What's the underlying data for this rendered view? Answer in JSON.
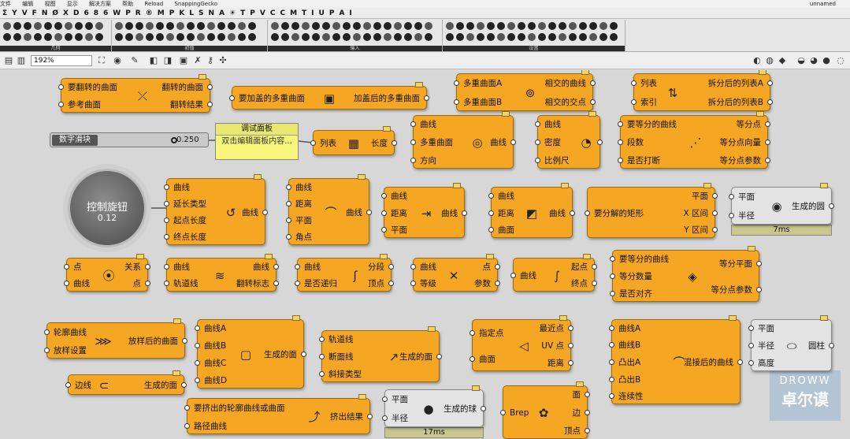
{
  "menubar": {
    "items": [
      "文件",
      "编辑",
      "视图",
      "显示",
      "解决方案",
      "帮助"
    ],
    "reload": "Reload",
    "plugin": "SnappingGecko",
    "doc": "unnamed"
  },
  "tabs": [
    "Σ",
    "Y",
    "V",
    "F",
    "N",
    "Ø",
    "X",
    "D",
    "6",
    "8",
    "6",
    "W",
    "P",
    "R",
    "®",
    "M",
    "P",
    "K",
    "L",
    "S",
    "N",
    "A",
    "☀",
    "T",
    "P",
    "V",
    "C",
    "C",
    "M",
    "T",
    "I",
    "U",
    "P",
    "A",
    "I"
  ],
  "ribbon_groups": [
    "几何",
    "初值",
    "输入",
    "设置"
  ],
  "toolbar": {
    "zoom": "192%"
  },
  "slider": {
    "name": "数字滑块",
    "value": "0.250"
  },
  "panel": {
    "title": "调试面板",
    "text": "双击编辑面板内容..."
  },
  "knob": {
    "name": "控制旋钮",
    "value": "0.12"
  },
  "timers": [
    "7ms",
    "17ms"
  ],
  "watermark": {
    "line1": "DROWW",
    "line2": "卓尔谟"
  },
  "nodes": [
    {
      "id": "flip",
      "inputs": [
        "要翻转的曲面",
        "参考曲面"
      ],
      "outputs": [
        "翻转的曲面",
        "翻转结果"
      ],
      "icon": "⤫"
    },
    {
      "id": "cap",
      "inputs": [
        "要加盖的多重曲面"
      ],
      "outputs": [
        "加盖后的多重曲面"
      ],
      "icon": "▣"
    },
    {
      "id": "mci",
      "inputs": [
        "多重曲面A",
        "多重曲面B"
      ],
      "outputs": [
        "相交的曲线",
        "相交的交点"
      ],
      "icon": "⊚"
    },
    {
      "id": "split",
      "inputs": [
        "列表",
        "索引"
      ],
      "outputs": [
        "拆分后的列表A",
        "拆分后的列表B"
      ],
      "icon": "⇅"
    },
    {
      "id": "len",
      "inputs": [
        "列表"
      ],
      "outputs": [
        "长度"
      ],
      "icon": "▦"
    },
    {
      "id": "offset",
      "inputs": [
        "曲线",
        "多重曲面",
        "方向"
      ],
      "outputs": [
        "曲线"
      ],
      "icon": "◎"
    },
    {
      "id": "fillet",
      "inputs": [
        "曲线",
        "密度",
        "比例尺"
      ],
      "outputs": [],
      "icon": "◔"
    },
    {
      "id": "divide",
      "inputs": [
        "要等分的曲线",
        "段数",
        "是否打断"
      ],
      "outputs": [
        "等分点",
        "等分点向量",
        "等分点参数"
      ],
      "icon": "⋰"
    },
    {
      "id": "extend",
      "inputs": [
        "曲线",
        "延长类型",
        "起点长度",
        "终点长度"
      ],
      "outputs": [
        "曲线"
      ],
      "icon": "↺"
    },
    {
      "id": "project",
      "inputs": [
        "曲线",
        "距离",
        "平面",
        "角点"
      ],
      "outputs": [
        "曲线"
      ],
      "icon": "⌒"
    },
    {
      "id": "offc",
      "inputs": [
        "曲线",
        "距离",
        "平面"
      ],
      "outputs": [
        "曲线"
      ],
      "icon": "⇥"
    },
    {
      "id": "offs",
      "inputs": [
        "曲线",
        "距离",
        "曲面"
      ],
      "outputs": [
        "曲线"
      ],
      "icon": "◩"
    },
    {
      "id": "rect",
      "inputs": [
        "要分解的矩形"
      ],
      "outputs": [
        "平面",
        "X 区间",
        "Y 区间"
      ],
      "icon": ""
    },
    {
      "id": "circle",
      "inputs": [
        "平面",
        "半径"
      ],
      "outputs": [
        "生成的圆"
      ],
      "icon": "◉"
    },
    {
      "id": "contain",
      "inputs": [
        "点",
        "曲线"
      ],
      "outputs": [
        "关系",
        "点"
      ],
      "icon": "⦿"
    },
    {
      "id": "orient",
      "inputs": [
        "曲线",
        "轨道线"
      ],
      "outputs": [
        "曲线",
        "翻转标志"
      ],
      "icon": "≋"
    },
    {
      "id": "shatter",
      "inputs": [
        "曲线",
        "是否递归"
      ],
      "outputs": [
        "分段",
        "顶点"
      ],
      "icon": "ʃ"
    },
    {
      "id": "evalc",
      "inputs": [
        "曲线",
        "等级"
      ],
      "outputs": [
        "点",
        "参数"
      ],
      "icon": "✕"
    },
    {
      "id": "endp",
      "inputs": [
        "曲线"
      ],
      "outputs": [
        "起点",
        "终点"
      ],
      "icon": "∫"
    },
    {
      "id": "perp",
      "inputs": [
        "要等分的曲线",
        "等分数量",
        "是否对齐"
      ],
      "outputs": [
        "等分平面",
        "等分点参数"
      ],
      "icon": "◈"
    },
    {
      "id": "loft",
      "inputs": [
        "轮廓曲线",
        "放样设置"
      ],
      "outputs": [
        "放样后的曲面"
      ],
      "icon": "⋙"
    },
    {
      "id": "edge",
      "inputs": [
        "边线"
      ],
      "outputs": [
        "生成的面"
      ],
      "icon": "⊂"
    },
    {
      "id": "srf4",
      "inputs": [
        "曲线A",
        "曲线B",
        "曲线C",
        "曲线D"
      ],
      "outputs": [
        "生成的面"
      ],
      "icon": "▢"
    },
    {
      "id": "sweep",
      "inputs": [
        "轨道线",
        "断面线",
        "斜接类型"
      ],
      "outputs": [
        "生成的面"
      ],
      "icon": "↗"
    },
    {
      "id": "cp",
      "inputs": [
        "指定点",
        "曲面"
      ],
      "outputs": [
        "最近点",
        "UV 点",
        "距离"
      ],
      "icon": "◁"
    },
    {
      "id": "blend",
      "inputs": [
        "曲线A",
        "曲线B",
        "凸出A",
        "凸出B",
        "连续性"
      ],
      "outputs": [
        "混接后的曲线"
      ],
      "icon": "⌒"
    },
    {
      "id": "cyl",
      "inputs": [
        "平面",
        "半径",
        "高度"
      ],
      "outputs": [
        "圆柱"
      ],
      "icon": "⬭"
    },
    {
      "id": "extr",
      "inputs": [
        "要挤出的轮廓曲线或曲面",
        "路径曲线"
      ],
      "outputs": [
        "挤出结果"
      ],
      "icon": "⤴"
    },
    {
      "id": "sphere",
      "inputs": [
        "平面",
        "半径"
      ],
      "outputs": [
        "生成的球"
      ],
      "icon": "●"
    },
    {
      "id": "brep",
      "inputs": [
        "Brep"
      ],
      "outputs": [
        "面",
        "边",
        "顶点"
      ],
      "icon": "✿"
    }
  ]
}
